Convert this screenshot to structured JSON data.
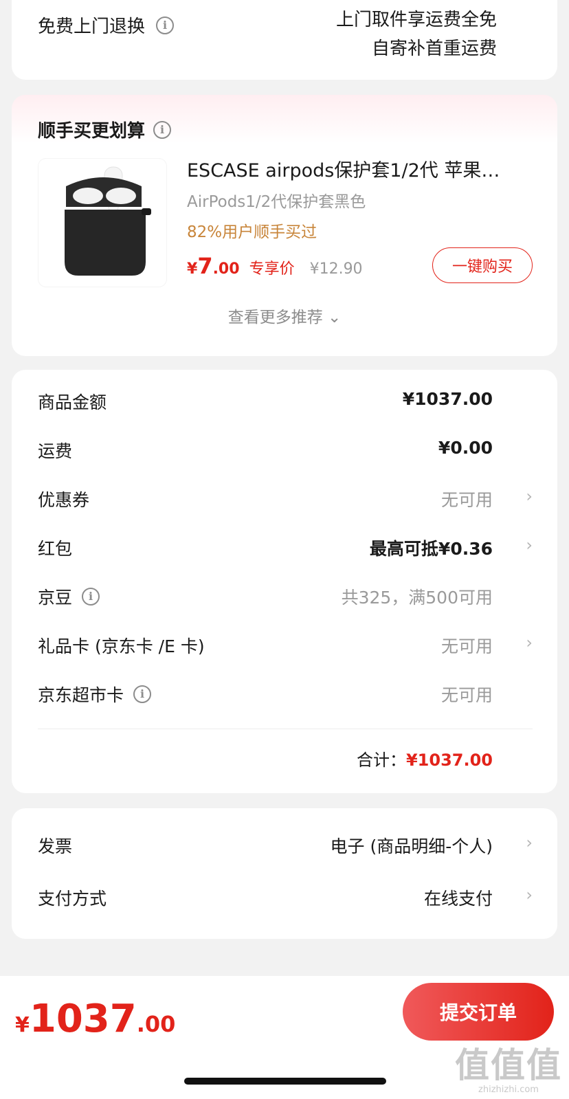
{
  "return_service": {
    "label": "免费上门退换",
    "line1": "上门取件享运费全免",
    "line2": "自寄补首重运费"
  },
  "recommend": {
    "title": "顺手买更划算",
    "product": {
      "name": "ESCASE airpods保护套1/2代 苹果…",
      "spec": "AirPods1/2代保护套黑色",
      "social": "82%用户顺手买过",
      "price_currency": "¥",
      "price_int": "7",
      "price_dec": ".00",
      "price_tag": "专享价",
      "original_price": "¥12.90",
      "buy_label": "一键购买"
    },
    "more_label": "查看更多推荐 ⌄"
  },
  "amounts": {
    "rows": [
      {
        "label": "商品金额",
        "value": "¥1037.00"
      },
      {
        "label": "运费",
        "value": "¥0.00"
      },
      {
        "label": "优惠券",
        "value": "无可用"
      },
      {
        "label": "红包",
        "value": "最高可抵¥0.36"
      },
      {
        "label": "京豆",
        "value": "共325，满500可用"
      },
      {
        "label": "礼品卡 (京东卡 /E 卡)",
        "value": "无可用"
      },
      {
        "label": "京东超市卡",
        "value": "无可用"
      }
    ],
    "total_label": "合计：",
    "total_value": "¥1037.00"
  },
  "invoice": {
    "rows": [
      {
        "label": "发票",
        "value": "电子 (商品明细-个人)"
      },
      {
        "label": "支付方式",
        "value": "在线支付"
      }
    ]
  },
  "bottom": {
    "currency": "¥",
    "price_int": "1037",
    "price_dec": ".00",
    "submit_label": "提交订单"
  },
  "watermark": {
    "big": "值值值",
    "small": "zhizhizhi.com"
  },
  "colors": {
    "accent": "#e2231a",
    "social": "#c8853a",
    "background": "#f2f2f2"
  }
}
